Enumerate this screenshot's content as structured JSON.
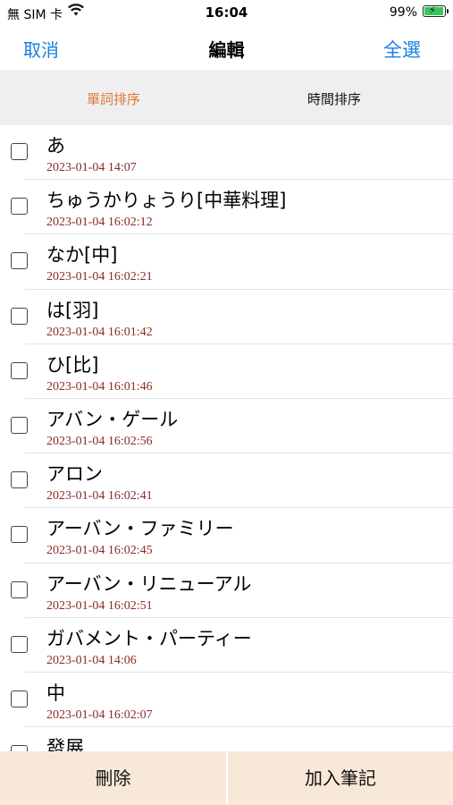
{
  "status_bar": {
    "carrier": "無 SIM 卡",
    "time": "16:04",
    "battery_percent": "99%"
  },
  "nav": {
    "cancel": "取消",
    "title": "編輯",
    "select_all": "全選"
  },
  "segments": {
    "word_sort": "單詞排序",
    "time_sort": "時間排序",
    "selected": "word_sort",
    "selected_color": "#e2762e"
  },
  "items": [
    {
      "word": "あ",
      "date": "2023-01-04 14:07"
    },
    {
      "word": "ちゅうかりょうり[中華料理]",
      "date": "2023-01-04 16:02:12"
    },
    {
      "word": "なか[中]",
      "date": "2023-01-04 16:02:21"
    },
    {
      "word": "は[羽]",
      "date": "2023-01-04 16:01:42"
    },
    {
      "word": "ひ[比]",
      "date": "2023-01-04 16:01:46"
    },
    {
      "word": "アバン・ゲール",
      "date": "2023-01-04 16:02:56"
    },
    {
      "word": "アロン",
      "date": "2023-01-04 16:02:41"
    },
    {
      "word": "アーバン・ファミリー",
      "date": "2023-01-04 16:02:45"
    },
    {
      "word": "アーバン・リニューアル",
      "date": "2023-01-04 16:02:51"
    },
    {
      "word": "ガバメント・パーティー",
      "date": "2023-01-04 14:06"
    },
    {
      "word": "中",
      "date": "2023-01-04 16:02:07"
    },
    {
      "word": "發展",
      "date": ""
    }
  ],
  "bottom": {
    "delete": "刪除",
    "add_note": "加入筆記"
  }
}
